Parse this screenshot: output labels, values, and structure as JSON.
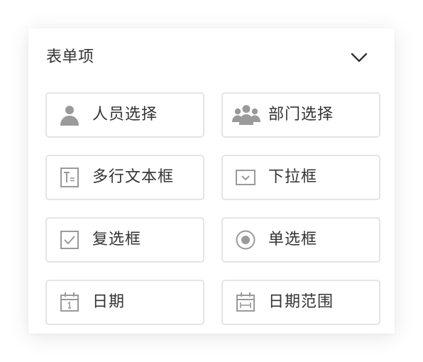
{
  "panel": {
    "title": "表单项",
    "toggle_icon": "chevron-down-icon"
  },
  "items": [
    {
      "label": "人员选择",
      "icon": "person-icon"
    },
    {
      "label": "部门选择",
      "icon": "group-icon"
    },
    {
      "label": "多行文本框",
      "icon": "multiline-text-icon"
    },
    {
      "label": "下拉框",
      "icon": "dropdown-icon"
    },
    {
      "label": "复选框",
      "icon": "checkbox-icon"
    },
    {
      "label": "单选框",
      "icon": "radio-icon"
    },
    {
      "label": "日期",
      "icon": "calendar-icon"
    },
    {
      "label": "日期范围",
      "icon": "date-range-icon"
    }
  ],
  "colors": {
    "icon": "#9a9a9a",
    "text": "#333333",
    "border": "#e4e4e4"
  }
}
